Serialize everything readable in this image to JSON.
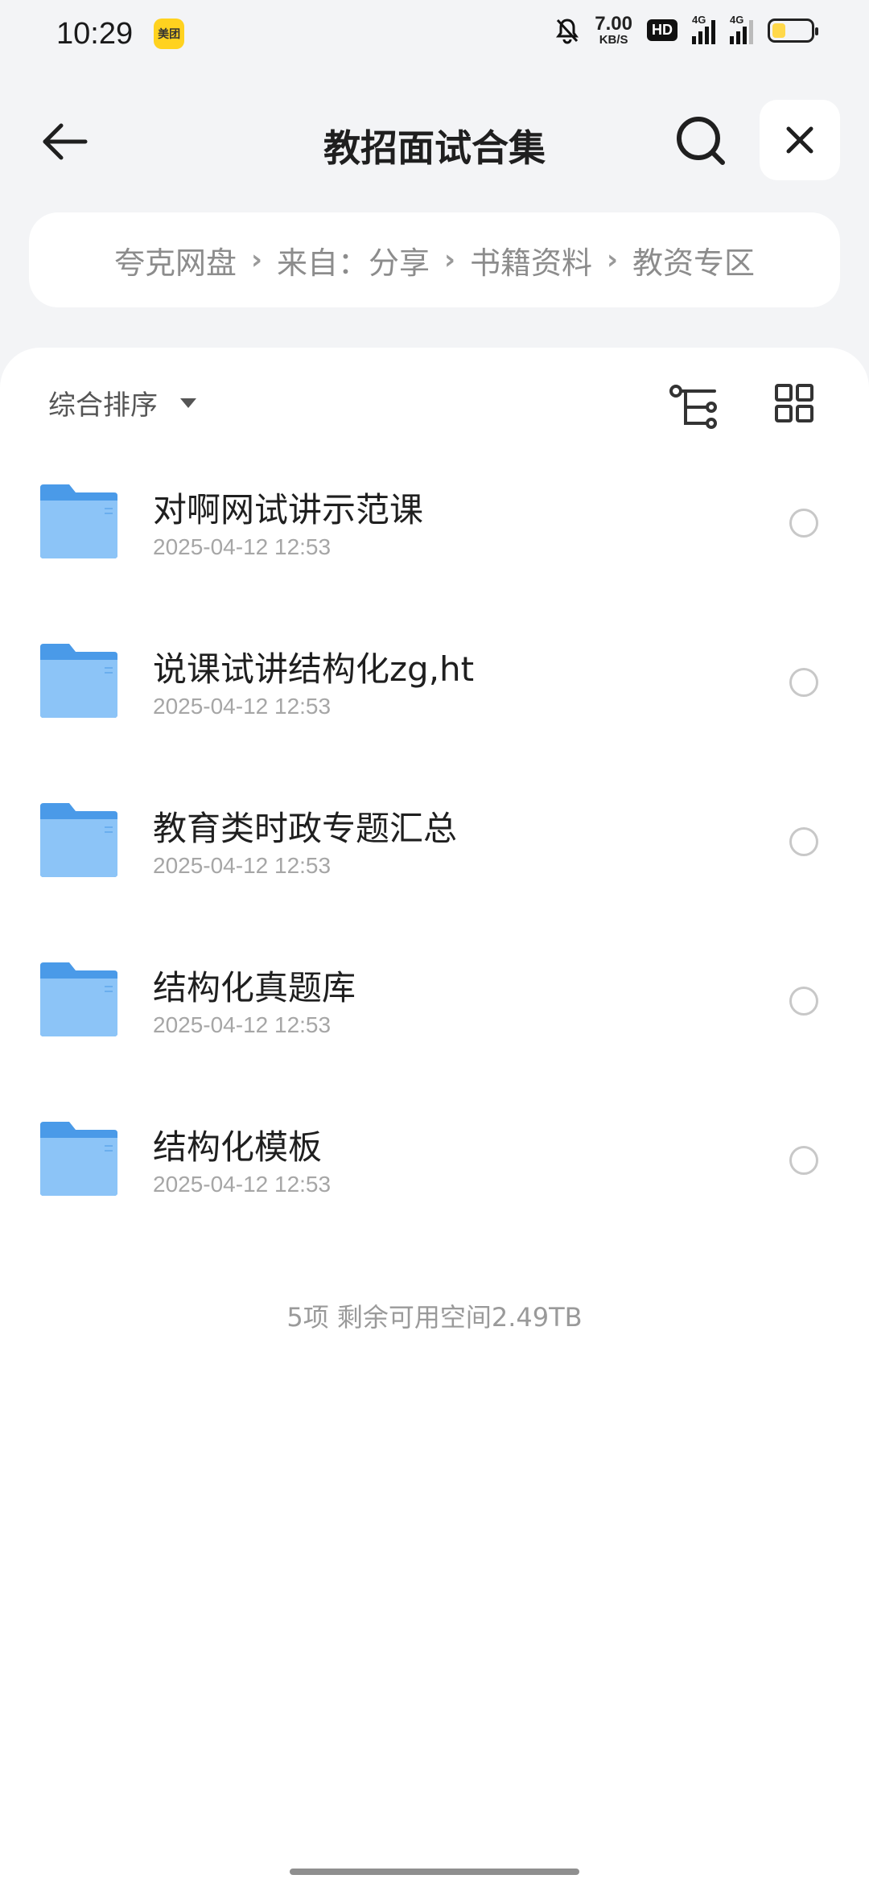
{
  "status_bar": {
    "time": "10:29",
    "app_badge": "美团",
    "net_speed_value": "7.00",
    "net_speed_unit": "KB/S",
    "hd_label": "HD",
    "signal1_label": "4G",
    "signal2_label": "4G",
    "battery_level": 0.35,
    "battery_color": "#ffd84a"
  },
  "header": {
    "title": "教招面试合集",
    "back_icon": "arrow-left-icon",
    "search_icon": "search-icon",
    "close_icon": "close-icon"
  },
  "breadcrumb": {
    "items": [
      "夸克网盘",
      "来自：分享",
      "书籍资料",
      "教资专区"
    ]
  },
  "toolbar": {
    "sort_label": "综合排序",
    "tree_icon": "tree-view-icon",
    "grid_icon": "grid-view-icon"
  },
  "files": [
    {
      "name": "对啊网试讲示范课",
      "date": "2025-04-12 12:53"
    },
    {
      "name": "说课试讲结构化zg,ht",
      "date": "2025-04-12 12:53"
    },
    {
      "name": "教育类时政专题汇总",
      "date": "2025-04-12 12:53"
    },
    {
      "name": "结构化真题库",
      "date": "2025-04-12 12:53"
    },
    {
      "name": "结构化模板",
      "date": "2025-04-12 12:53"
    }
  ],
  "footer": {
    "info": "5项 剩余可用空间2.49TB"
  },
  "colors": {
    "folder": "#5aa9f0",
    "background": "#f3f4f6",
    "panel": "#ffffff"
  }
}
